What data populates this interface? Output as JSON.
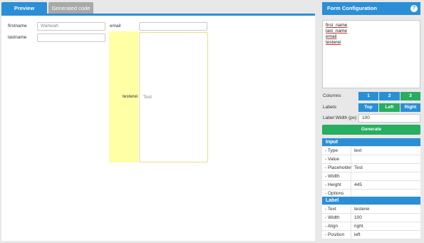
{
  "tabs": {
    "preview": "Preview",
    "generated": "Generated code"
  },
  "form": {
    "firstname_label": "firstname",
    "firstname_placeholder": "Wahwah",
    "email_label": "email",
    "lastname_label": "lastname",
    "testerei_label": "testerei",
    "testerei_placeholder": "Test"
  },
  "config": {
    "title": "Form Configuration",
    "help": "?",
    "fields": [
      "first_name",
      "last_name",
      "email",
      "testerei"
    ],
    "columns_label": "Columns",
    "columns": [
      "1",
      "2",
      "3"
    ],
    "columns_selected": "3",
    "labels_label": "Labels",
    "label_positions": [
      "Top",
      "Left",
      "Right"
    ],
    "label_position_selected": "Left",
    "label_width_label": "Label Width (px)",
    "label_width_value": "100",
    "generate": "Generate"
  },
  "input_section": {
    "title": "Input",
    "rows": [
      {
        "key": "- Type",
        "value": "text"
      },
      {
        "key": "- Value",
        "value": ""
      },
      {
        "key": "- Placeholder",
        "value": "Test"
      },
      {
        "key": "- Width",
        "value": ""
      },
      {
        "key": "- Height",
        "value": "445"
      },
      {
        "key": "- Options",
        "value": ""
      }
    ]
  },
  "label_section": {
    "title": "Label",
    "rows": [
      {
        "key": "- Text",
        "value": "testerei"
      },
      {
        "key": "- Width",
        "value": "100"
      },
      {
        "key": "- Align",
        "value": "right"
      },
      {
        "key": "- Position",
        "value": "left"
      }
    ]
  },
  "colors": {
    "accent": "#2b8fd6",
    "success": "#27ae60",
    "label_highlight": "#ffffa6"
  }
}
